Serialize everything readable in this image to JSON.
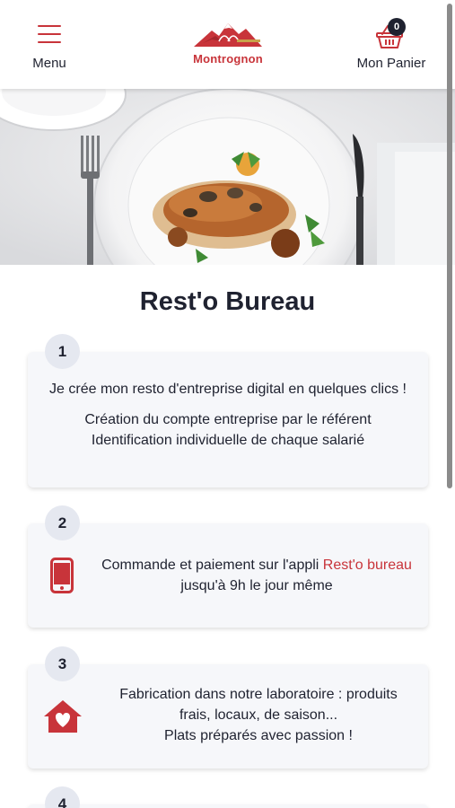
{
  "header": {
    "menu_label": "Menu",
    "brand_name": "Montrognon",
    "cart_label": "Mon Panier",
    "cart_count": "0"
  },
  "page": {
    "title": "Rest'o Bureau"
  },
  "steps": [
    {
      "number": "1",
      "line1": "Je crée mon resto d'entreprise digital en quelques clics !",
      "line2": "Création du compte entreprise par le référent Identification individuelle de chaque salarié"
    },
    {
      "number": "2",
      "icon": "smartphone-icon",
      "text_before": "Commande et paiement sur l'appli ",
      "text_accent": "Rest'o bureau",
      "text_after": " jusqu'à 9h le jour même"
    },
    {
      "number": "3",
      "icon": "home-heart-icon",
      "line1": "Fabrication dans notre laboratoire : produits frais, locaux, de saison...",
      "line2": "Plats préparés avec passion !"
    },
    {
      "number": "4"
    }
  ],
  "colors": {
    "accent": "#c8343a",
    "text": "#1f2230",
    "card_bg": "#f6f7fa",
    "badge_bg": "#e5e8f0"
  }
}
